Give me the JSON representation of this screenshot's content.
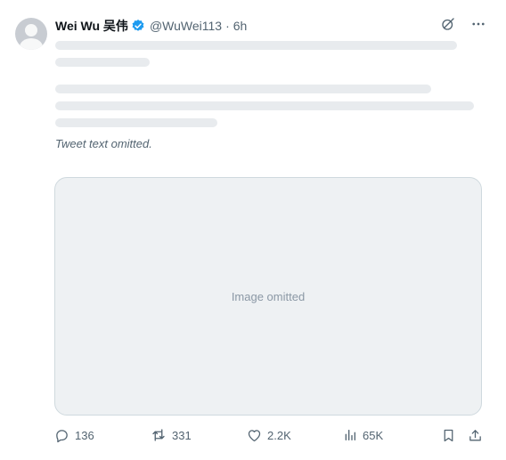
{
  "author": {
    "name": "Wei Wu 吴伟",
    "handle": "@WuWei113",
    "separator": "·",
    "time": "6h"
  },
  "notice": "Tweet text omitted.",
  "media_label": "Image omitted",
  "stats": {
    "replies": "136",
    "retweets": "331",
    "likes": "2.2K",
    "views": "65K"
  },
  "colors": {
    "verified": "#1d9bf0",
    "muted": "#536471",
    "text": "#0f1419"
  },
  "icons": [
    "verified-badge-icon",
    "grok-icon",
    "more-icon",
    "reply-icon",
    "retweet-icon",
    "like-icon",
    "views-icon",
    "bookmark-icon",
    "share-icon"
  ]
}
